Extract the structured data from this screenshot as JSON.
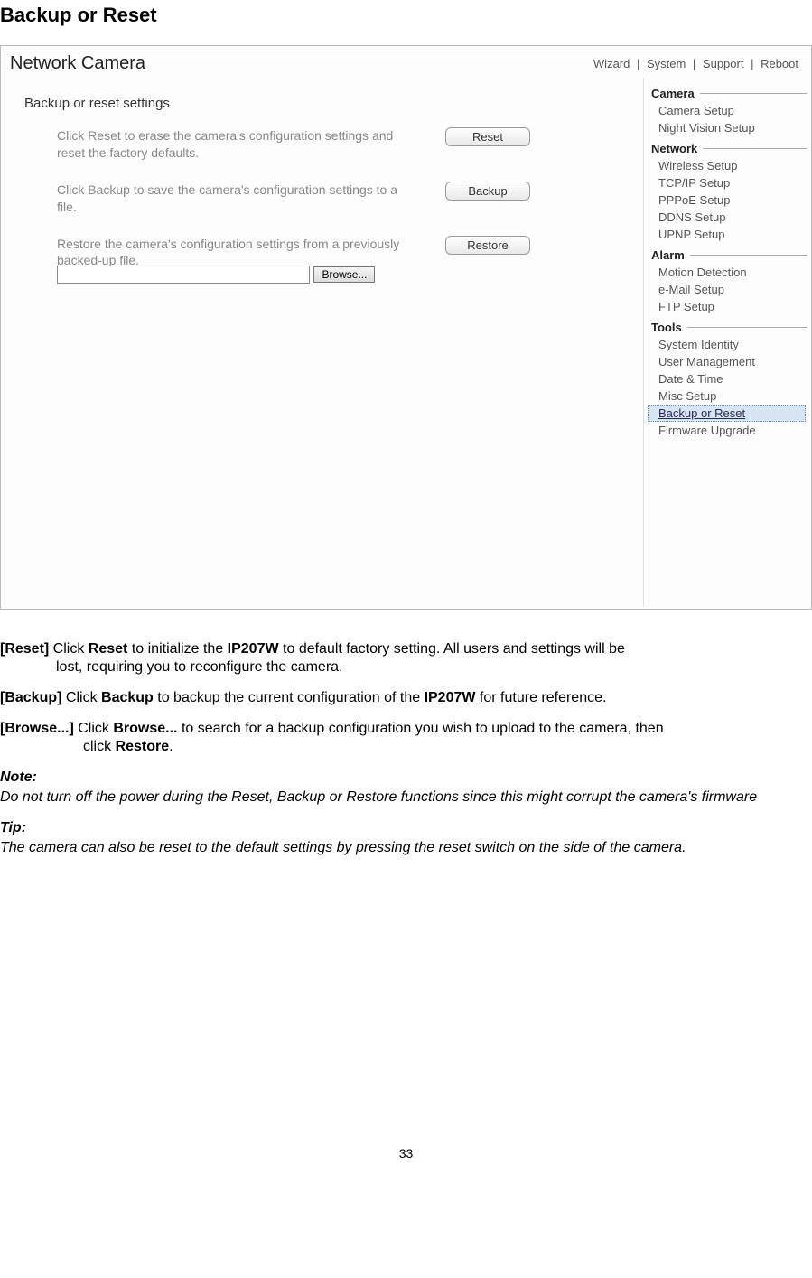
{
  "page": {
    "title": "Backup or Reset",
    "number": "33"
  },
  "app": {
    "title": "Network Camera",
    "top_links": [
      "Wizard",
      "System",
      "Support",
      "Reboot"
    ],
    "section_title": "Backup or reset settings",
    "reset_desc": "Click Reset to erase the camera's configuration settings and reset the factory defaults.",
    "reset_btn": "Reset",
    "backup_desc": "Click Backup to save the camera's configuration settings to a file.",
    "backup_btn": "Backup",
    "restore_desc": "Restore the camera's configuration settings from a previously backed-up file.",
    "restore_btn": "Restore",
    "browse_btn": "Browse...",
    "file_value": ""
  },
  "sidebar": {
    "sections": [
      {
        "header": "Camera",
        "items": [
          "Camera Setup",
          "Night Vision Setup"
        ]
      },
      {
        "header": "Network",
        "items": [
          "Wireless Setup",
          "TCP/IP Setup",
          "PPPoE Setup",
          "DDNS Setup",
          "UPNP Setup"
        ]
      },
      {
        "header": "Alarm",
        "items": [
          "Motion Detection",
          "e-Mail Setup",
          "FTP Setup"
        ]
      },
      {
        "header": "Tools",
        "items": [
          "System Identity",
          "User Management",
          "Date & Time",
          "Misc Setup",
          "Backup or Reset",
          "Firmware Upgrade"
        ]
      }
    ],
    "selected": "Backup or Reset"
  },
  "manual": {
    "reset_label": "[Reset]",
    "reset_line1": " Click ",
    "reset_bold1": "Reset",
    "reset_line2": " to initialize the ",
    "reset_bold2": "IP207W",
    "reset_line3": " to default factory setting. All users and settings will be",
    "reset_line4": "lost, requiring you to reconfigure the camera.",
    "backup_label": "[Backup]",
    "backup_line1": " Click ",
    "backup_bold1": "Backup",
    "backup_line2": " to backup the current configuration of the ",
    "backup_bold2": "IP207W",
    "backup_line3": " for future reference.",
    "browse_label": "[Browse...]",
    "browse_line1": " Click ",
    "browse_bold1": "Browse...",
    "browse_line2": " to search for a backup configuration you wish to upload to the camera, then",
    "browse_line3": "click ",
    "browse_bold2": "Restore",
    "browse_line4": ".",
    "note_label": "Note:",
    "note_text": "Do not turn off the power during the Reset, Backup or Restore functions since this might corrupt the camera's firmware",
    "tip_label": "Tip:",
    "tip_text": "The camera can also be reset to the default settings by pressing the reset switch on the side of the camera."
  }
}
